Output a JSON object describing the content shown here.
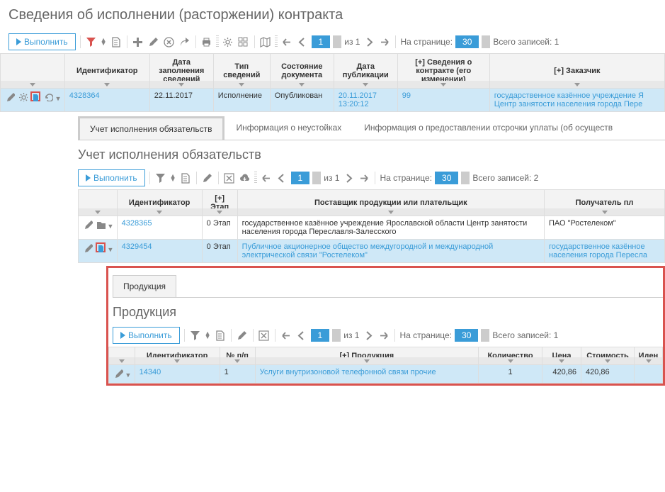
{
  "page_title": "Сведения об исполнении (расторжении) контракта",
  "exec_btn": "Выполнить",
  "pager": {
    "page": "1",
    "of_label": "из 1",
    "per_page_label": "На странице:",
    "per_page": "30",
    "total_label_1": "Всего записей: 1",
    "total_label_2": "Всего записей: 2"
  },
  "main_table": {
    "headers": {
      "id": "Идентификатор",
      "fill_date": "Дата заполнения сведений",
      "type": "Тип сведений",
      "doc_state": "Состояние документа",
      "pub_date": "Дата публикации",
      "contract_info": "[+] Сведения о контракте (его изменении)",
      "customer": "[+] Заказчик"
    },
    "row": {
      "id": "4328364",
      "fill_date": "22.11.2017",
      "type": "Исполнение",
      "doc_state": "Опубликован",
      "pub_date": "20.11.2017 13:20:12",
      "contract_info": "99",
      "customer": "государственное казённое учреждение Я Центр занятости населения города Пере"
    }
  },
  "tabs": {
    "t1": "Учет исполнения обязательств",
    "t2": "Информация о неустойках",
    "t3": "Информация о предоставлении отсрочки уплаты (об осуществ"
  },
  "sub_section_title": "Учет исполнения обязательств",
  "sub_table": {
    "headers": {
      "id": "Идентификатор",
      "stage": "[+] Этап",
      "supplier": "Поставщик продукции или плательщик",
      "recipient": "Получатель пл"
    },
    "rows": [
      {
        "id": "4328365",
        "stage": "0 Этап",
        "supplier": "государственное казённое учреждение Ярославской области Центр занятости населения города Переславля-Залесского",
        "recipient": "ПАО \"Ростелеком\""
      },
      {
        "id": "4329454",
        "stage": "0 Этап",
        "supplier": "Публичное акционерное общество междугородной и международной электрической связи \"Ростелеком\"",
        "recipient": "государственное казённое населения города Пересла"
      }
    ]
  },
  "prod_tab": "Продукция",
  "prod_title": "Продукция",
  "prod_table": {
    "headers": {
      "id": "Идентификатор",
      "num": "№ п/п",
      "product": "[+] Продукция",
      "qty": "Количество",
      "price": "Цена",
      "cost": "Стоимость",
      "ident": "Иден"
    },
    "row": {
      "id": "14340",
      "num": "1",
      "product": "Услуги внутризоновой телефонной связи прочие",
      "qty": "1",
      "price": "420,86",
      "cost": "420,86"
    }
  }
}
